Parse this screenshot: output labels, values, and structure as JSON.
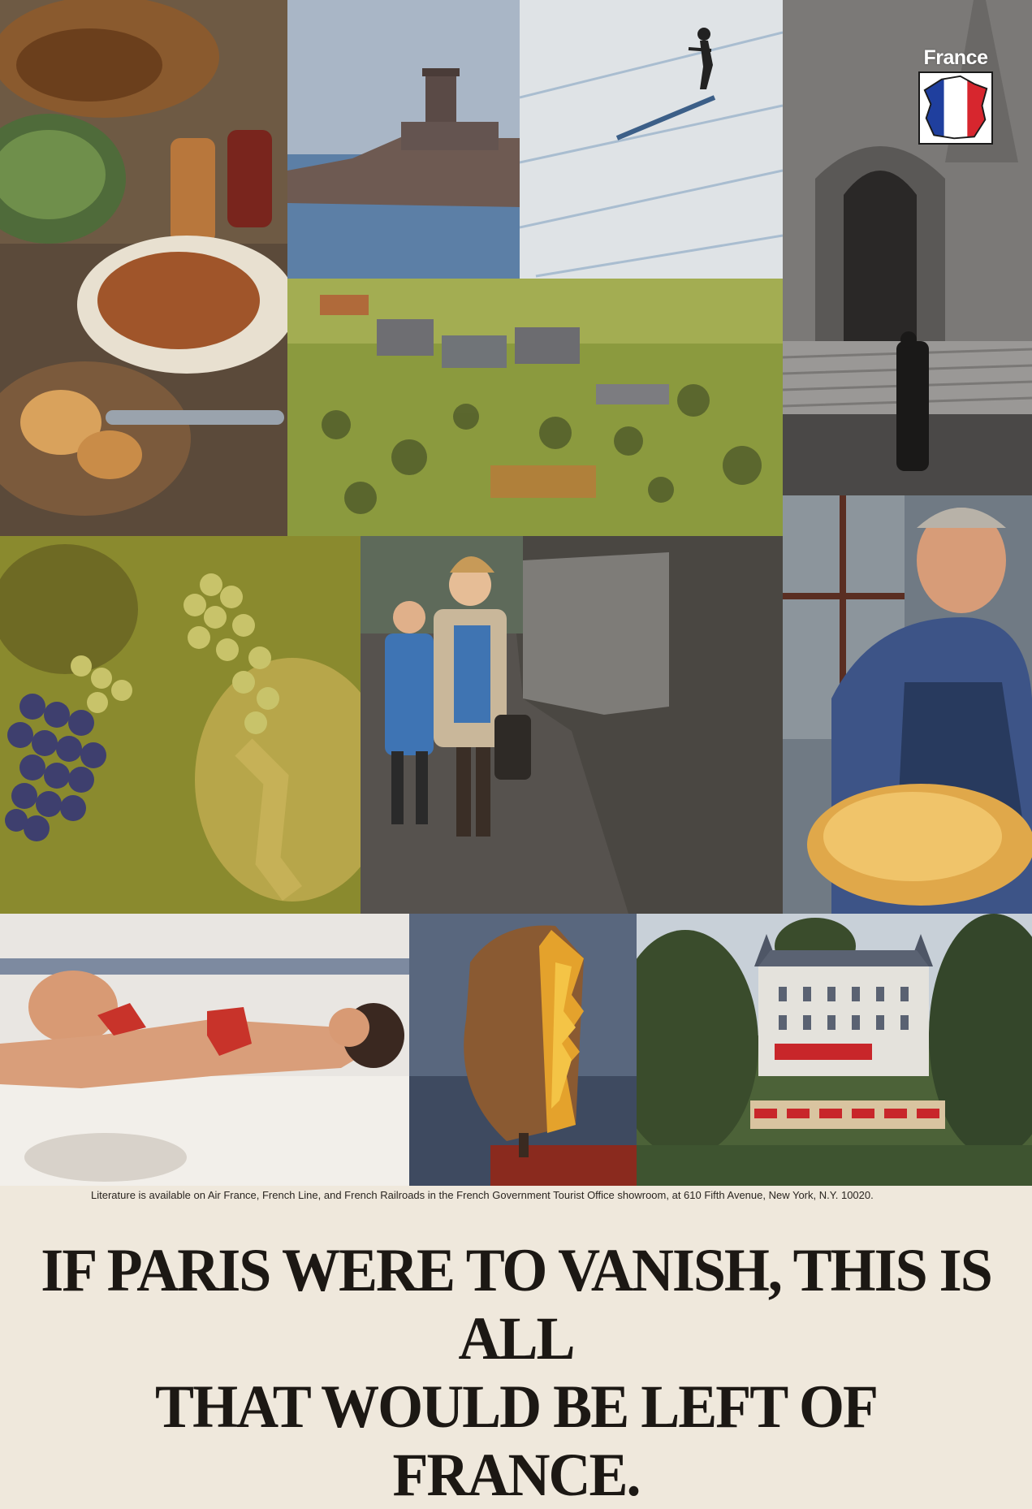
{
  "logo": {
    "word": "France",
    "flag_colors": {
      "blue": "#1f3f9e",
      "white": "#ffffff",
      "red": "#d7262e"
    }
  },
  "photos": [
    {
      "id": "food",
      "icon": "food-still-life-photo"
    },
    {
      "id": "castle",
      "icon": "seaside-castle-photo"
    },
    {
      "id": "skier",
      "icon": "skier-photo"
    },
    {
      "id": "cathedral",
      "icon": "cathedral-photo"
    },
    {
      "id": "village",
      "icon": "village-countryside-photo"
    },
    {
      "id": "grapes",
      "icon": "grape-vine-photo"
    },
    {
      "id": "children",
      "icon": "children-walking-photo"
    },
    {
      "id": "woman",
      "icon": "woman-with-pastries-photo"
    },
    {
      "id": "beach",
      "icon": "sunbather-beach-photo"
    },
    {
      "id": "sculpture",
      "icon": "sculpture-face-photo"
    },
    {
      "id": "chateau",
      "icon": "chateau-photo"
    }
  ],
  "fine_print": "Literature is available on Air France, French Line, and French Railroads in the French Government Tourist Office showroom, at 610 Fifth Avenue, New York, N.Y. 10020.",
  "headline": {
    "line1": "IF PARIS WERE TO VANISH, THIS IS ALL",
    "line2": "THAT WOULD BE LEFT OF FRANCE."
  }
}
